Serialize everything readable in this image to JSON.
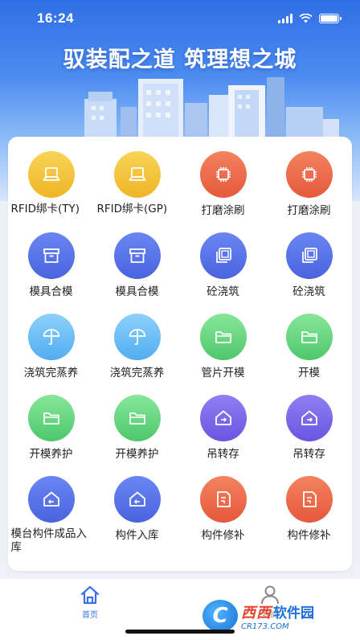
{
  "status_bar": {
    "time": "16:24"
  },
  "header": {
    "slogan": "驭装配之道 筑理想之城"
  },
  "colors": {
    "yellow": "#efb526",
    "red": "#e6583c",
    "blue": "#4a63df",
    "sky": "#51adf1",
    "green": "#4ec86b",
    "purple": "#6a55e0",
    "accent": "#3a6fe8"
  },
  "grid": {
    "items": [
      {
        "label": "RFID绑卡(TY)",
        "color": "yellow",
        "icon": "tablet-icon"
      },
      {
        "label": "RFID绑卡(GP)",
        "color": "yellow",
        "icon": "tablet-icon"
      },
      {
        "label": "打磨涂刷",
        "color": "red",
        "icon": "chip-icon"
      },
      {
        "label": "打磨涂刷",
        "color": "red",
        "icon": "chip-icon"
      },
      {
        "label": "模具合模",
        "color": "blue",
        "icon": "box-icon"
      },
      {
        "label": "模具合模",
        "color": "blue",
        "icon": "box-icon"
      },
      {
        "label": "砼浇筑",
        "color": "blue",
        "icon": "layers-icon"
      },
      {
        "label": "砼浇筑",
        "color": "blue",
        "icon": "layers-icon"
      },
      {
        "label": "浇筑完蒸养",
        "color": "sky",
        "icon": "umbrella-icon"
      },
      {
        "label": "浇筑完蒸养",
        "color": "sky",
        "icon": "umbrella-icon"
      },
      {
        "label": "管片开模",
        "color": "green",
        "icon": "folder-icon"
      },
      {
        "label": "开模",
        "color": "green",
        "icon": "folder-icon"
      },
      {
        "label": "开模养护",
        "color": "green",
        "icon": "folder-icon"
      },
      {
        "label": "开模养护",
        "color": "green",
        "icon": "folder-icon"
      },
      {
        "label": "吊转存",
        "color": "purple",
        "icon": "house-transfer-icon"
      },
      {
        "label": "吊转存",
        "color": "purple",
        "icon": "house-transfer-icon"
      },
      {
        "label": "模台构件成品入库",
        "color": "blue",
        "icon": "house-in-icon"
      },
      {
        "label": "构件入库",
        "color": "blue",
        "icon": "house-in-icon"
      },
      {
        "label": "构件修补",
        "color": "red",
        "icon": "repair-doc-icon"
      },
      {
        "label": "构件修补",
        "color": "red",
        "icon": "repair-doc-icon"
      }
    ]
  },
  "bottom_nav": {
    "home": {
      "label": "首页",
      "icon": "home-icon",
      "active": true
    },
    "mine": {
      "label": "我的",
      "icon": "user-icon",
      "active": false
    }
  },
  "watermark": {
    "logo_text": "C",
    "name": "西西",
    "sub": "软件园",
    "url": "CR173.COM"
  }
}
